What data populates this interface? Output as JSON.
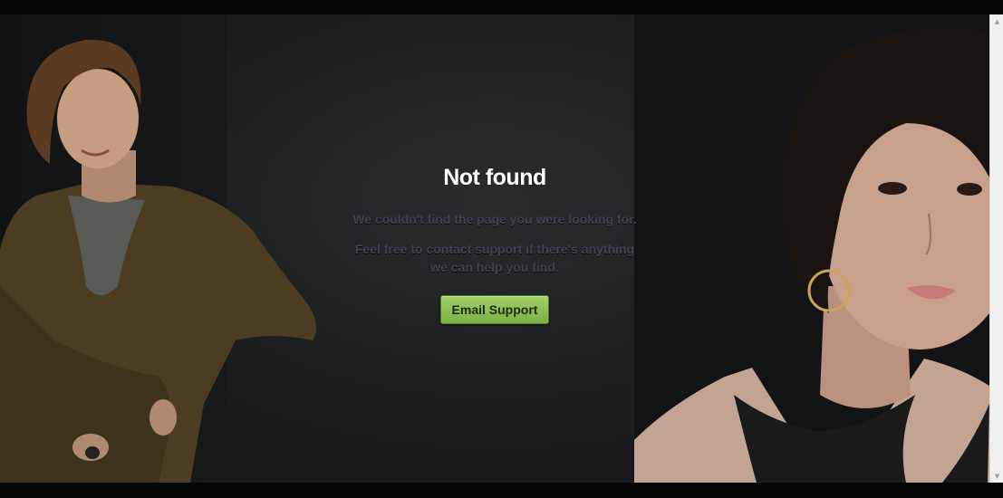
{
  "page": {
    "title": "Not found",
    "message_line1": "We couldn't find the page you were looking for.",
    "message_line2": "Feel free to contact support if there's anything we can help you find.",
    "button_label": "Email Support"
  },
  "colors": {
    "background": "#1d1e20",
    "title": "#ffffff",
    "message": "#3c4250",
    "button_top": "#a5d06b",
    "button_bottom": "#7bb045"
  },
  "icons": {
    "scroll_up": "triangle-up-icon",
    "scroll_down": "triangle-down-icon"
  }
}
